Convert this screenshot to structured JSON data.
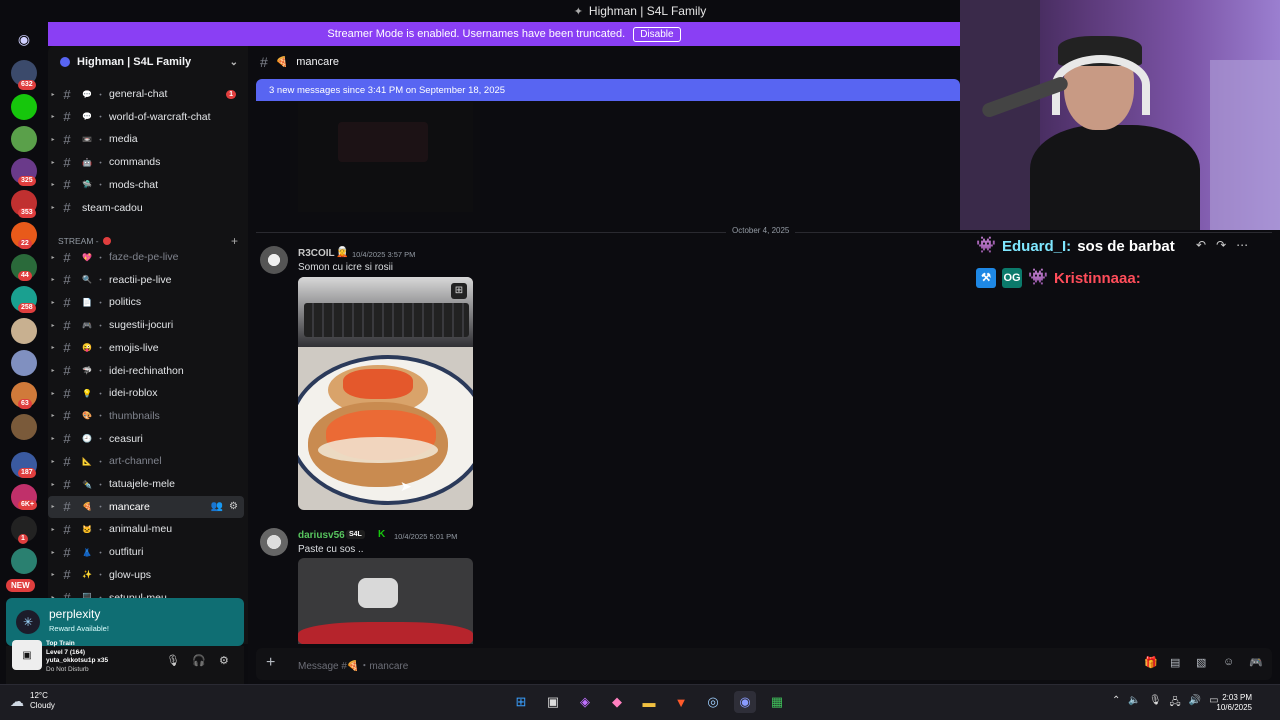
{
  "window": {
    "title": "Highman | S4L Family"
  },
  "banner": {
    "text": "Streamer Mode is enabled. Usernames have been truncated.",
    "button": "Disable"
  },
  "server": {
    "name": "Highman | S4L Family"
  },
  "rail": {
    "badges": [
      "632",
      "325",
      "353",
      "22",
      "44",
      "258",
      "63",
      "187",
      "6K+",
      "1"
    ],
    "new_label": "NEW"
  },
  "sidebar": {
    "channels_top": [
      {
        "name": "general-chat",
        "emoji": "💬",
        "unread": "1"
      },
      {
        "name": "world-of-warcraft-chat",
        "emoji": "💬"
      },
      {
        "name": "media",
        "emoji": "📼"
      },
      {
        "name": "commands",
        "emoji": "🤖"
      },
      {
        "name": "mods-chat",
        "emoji": "🛸"
      },
      {
        "name": "steam-cadou"
      }
    ],
    "category": "STREAM -",
    "channels_stream": [
      {
        "name": "faze-de-pe-live",
        "emoji": "💖",
        "muted": true
      },
      {
        "name": "reactii-pe-live",
        "emoji": "🔍"
      },
      {
        "name": "politics",
        "emoji": "📄"
      },
      {
        "name": "sugestii-jocuri",
        "emoji": "🎮"
      },
      {
        "name": "emojis-live",
        "emoji": "😜"
      },
      {
        "name": "idei-rechinathon",
        "emoji": "🦈"
      },
      {
        "name": "idei-roblox",
        "emoji": "💡"
      },
      {
        "name": "thumbnails",
        "emoji": "🎨",
        "muted": true
      },
      {
        "name": "ceasuri",
        "emoji": "🕘"
      },
      {
        "name": "art-channel",
        "emoji": "📐",
        "muted": true
      },
      {
        "name": "tatuajele-mele",
        "emoji": "✒️"
      },
      {
        "name": "mancare",
        "emoji": "🍕",
        "active": true
      },
      {
        "name": "animalul-meu",
        "emoji": "🐱"
      },
      {
        "name": "outfituri",
        "emoji": "👗"
      },
      {
        "name": "glow-ups",
        "emoji": "✨"
      },
      {
        "name": "setupul-meu",
        "emoji": "🖥️"
      }
    ]
  },
  "promo": {
    "title": "perplexity",
    "subtitle": "Reward Available!"
  },
  "user": {
    "line1": "Top Train",
    "line2": "Level 7 (164)",
    "line3": "yuta_okkotsu1p x35",
    "line4": "Do Not Disturb"
  },
  "chat": {
    "channel": "mancare",
    "new_messages": "3 new messages since 3:41 PM on September 18, 2025",
    "date_separator": "October 4, 2025",
    "messages": [
      {
        "author": "R3COIL",
        "time": "10/4/2025 3:57 PM",
        "text": "Somon cu icre si rosii"
      },
      {
        "author": "dariusv56",
        "tag": "S4L",
        "time": "10/4/2025 5:01 PM",
        "text": "Paste cu sos .."
      }
    ],
    "composer_placeholder": "Message #🍕・mancare"
  },
  "overlay": [
    {
      "user": "Eduard_I:",
      "text": "sos de barbat"
    },
    {
      "user": "Kristinnaaa:",
      "text": ""
    }
  ],
  "taskbar": {
    "weather_temp": "12°C",
    "weather_desc": "Cloudy",
    "time": "2:03 PM",
    "date": "10/6/2025"
  },
  "colors": {
    "accent": "#5865f2",
    "banner": "#8a3ff4",
    "badge_red": "#e03e3e",
    "promo": "#0f6e73"
  }
}
